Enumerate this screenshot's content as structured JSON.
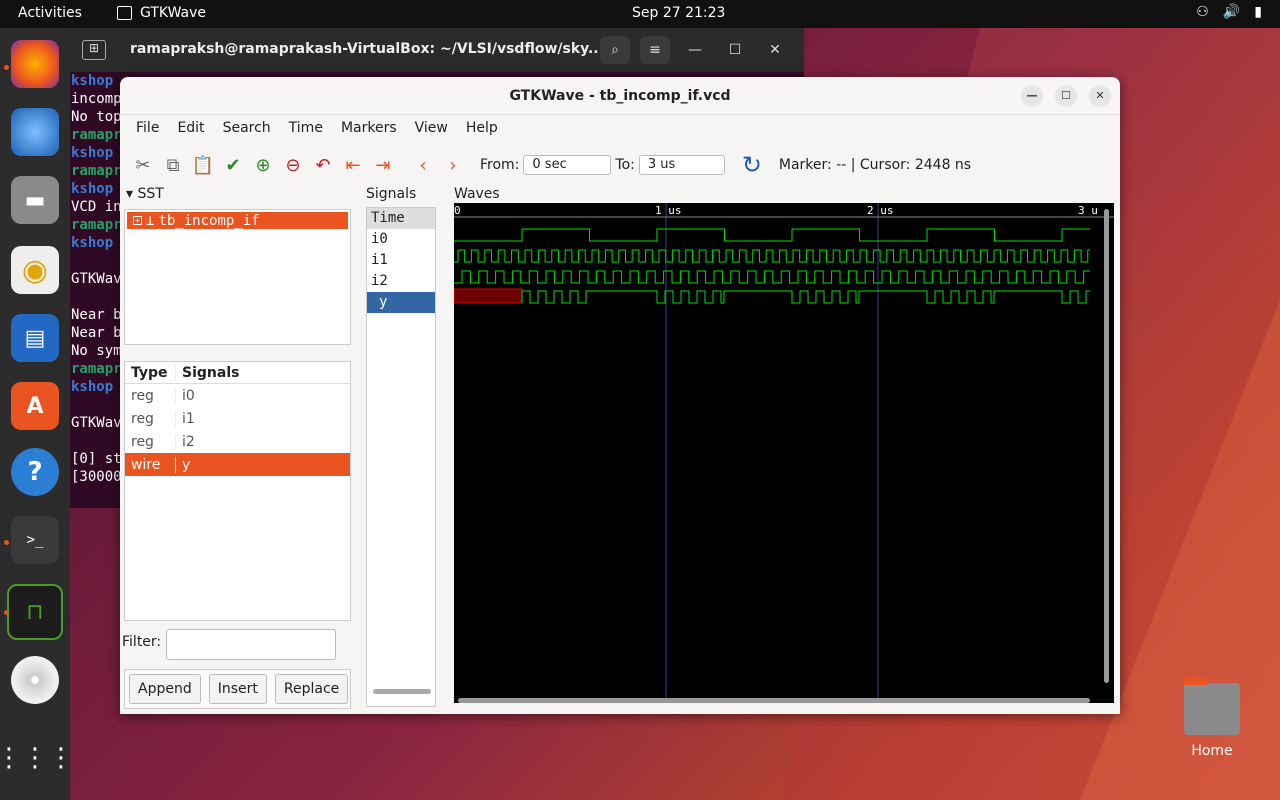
{
  "topbar": {
    "activities": "Activities",
    "app": "GTKWave",
    "clock": "Sep 27  21:23",
    "tray": [
      "network-icon",
      "volume-icon",
      "battery-icon"
    ]
  },
  "dock": {
    "items": [
      "firefox",
      "thunderbird",
      "files",
      "rhythmbox",
      "writer",
      "app-center",
      "help",
      "terminal",
      "gtkwave",
      "disc",
      "apps-grid"
    ]
  },
  "terminal": {
    "title": "ramapraksh@ramaprakash-VirtualBox: ~/VLSI/vsdflow/sky...",
    "lines": [
      {
        "t": "kshop",
        "c": "bl"
      },
      {
        "t": "incomp",
        "c": ""
      },
      {
        "t": "No top",
        "c": ""
      },
      {
        "t": "ramapr",
        "c": "g"
      },
      {
        "t": "kshop",
        "c": "bl"
      },
      {
        "t": "ramapr",
        "c": "g"
      },
      {
        "t": "kshop",
        "c": "bl"
      },
      {
        "t": "VCD in",
        "c": ""
      },
      {
        "t": "ramapr",
        "c": "g"
      },
      {
        "t": "kshop",
        "c": "bl"
      },
      {
        "t": "",
        "c": ""
      },
      {
        "t": "GTKWav",
        "c": ""
      },
      {
        "t": "",
        "c": ""
      },
      {
        "t": "Near b",
        "c": ""
      },
      {
        "t": "Near b",
        "c": ""
      },
      {
        "t": "No sym",
        "c": ""
      },
      {
        "t": "ramapr",
        "c": "g"
      },
      {
        "t": "kshop",
        "c": "bl"
      },
      {
        "t": "",
        "c": ""
      },
      {
        "t": "GTKWav",
        "c": ""
      },
      {
        "t": "",
        "c": ""
      },
      {
        "t": "[0] st",
        "c": ""
      },
      {
        "t": "[30000",
        "c": ""
      }
    ]
  },
  "window": {
    "title": "GTKWave - tb_incomp_if.vcd"
  },
  "menu": [
    "File",
    "Edit",
    "Search",
    "Time",
    "Markers",
    "View",
    "Help"
  ],
  "toolbar": {
    "from_label": "From:",
    "from_value": "0 sec",
    "to_label": "To:",
    "to_value": "3 us",
    "marker_text": "Marker: --  |  Cursor: 2448 ns"
  },
  "sst": {
    "label": "SST",
    "tree_item": "tb_incomp_if"
  },
  "signals_table": {
    "headers": [
      "Type",
      "Signals"
    ],
    "rows": [
      {
        "type": "reg",
        "name": "i0"
      },
      {
        "type": "reg",
        "name": "i1"
      },
      {
        "type": "reg",
        "name": "i2"
      },
      {
        "type": "wire",
        "name": "y"
      }
    ]
  },
  "filter": {
    "label": "Filter:",
    "value": ""
  },
  "actions": {
    "append": "Append",
    "insert": "Insert",
    "replace": "Replace"
  },
  "signals_panel": {
    "label": "Signals",
    "names": [
      "Time",
      "i0",
      "i1",
      "i2",
      "y"
    ]
  },
  "waves_panel": {
    "label": "Waves",
    "ticks": [
      "0",
      "1 us",
      "2 us",
      "3 u"
    ]
  },
  "desktop": {
    "home": "Home"
  }
}
